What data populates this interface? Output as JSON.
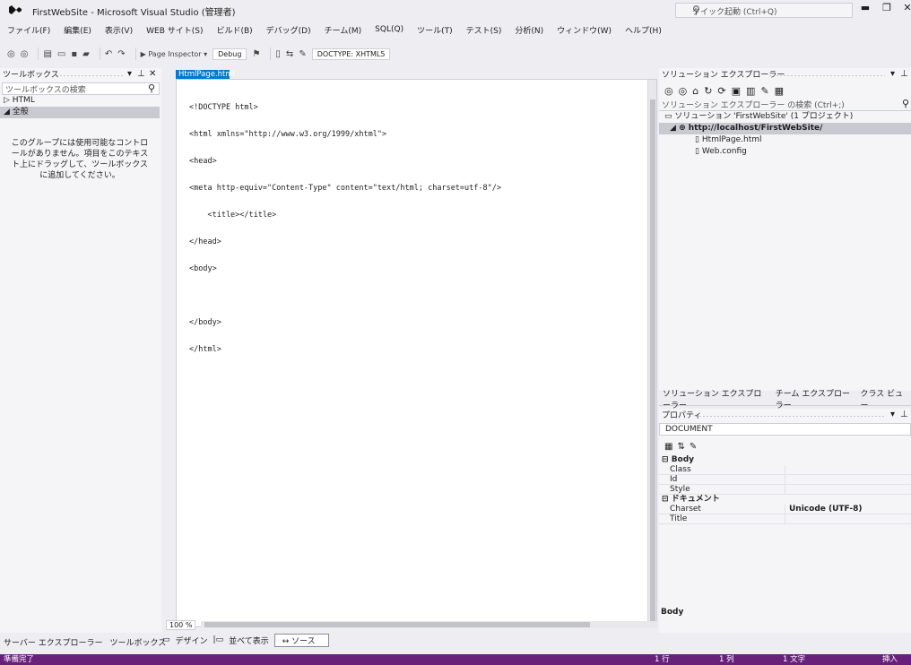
{
  "window": {
    "title": "FirstWebSite - Microsoft Visual Studio (管理者)",
    "quick_launch": "クイック起動 (Ctrl+Q)",
    "minimize": "▬",
    "maximize": "❐",
    "close": "✕"
  },
  "menu": [
    "ファイル(F)",
    "編集(E)",
    "表示(V)",
    "WEB サイト(S)",
    "ビルド(B)",
    "デバッグ(D)",
    "チーム(M)",
    "SQL(Q)",
    "ツール(T)",
    "テスト(S)",
    "分析(N)",
    "ウィンドウ(W)",
    "ヘルプ(H)"
  ],
  "toolbar": {
    "run_label": "▶ Page Inspector ▾",
    "config": "Debug",
    "doctype": "DOCTYPE: XHTML5"
  },
  "toolbox": {
    "title": "ツールボックス",
    "search_placeholder": "ツールボックスの検索",
    "groups": [
      "▷ HTML",
      "◢ 全般"
    ],
    "message": "このグループには使用可能なコントロールがありません。項目をこのテキスト上にドラッグして、ツールボックスに追加してください。"
  },
  "editor": {
    "tab": "HtmlPage.html",
    "lines": [
      "<!DOCTYPE html>",
      "<html xmlns=\"http://www.w3.org/1999/xhtml\">",
      "<head>",
      "<meta http-equiv=\"Content-Type\" content=\"text/html; charset=utf-8\"/>",
      "    <title></title>",
      "</head>",
      "<body>",
      "",
      "</body>",
      "</html>"
    ],
    "zoom": "100 %"
  },
  "view_tabs": {
    "design": "デザイン",
    "split": "並べて表示",
    "source": "ソース"
  },
  "left_bottom_tabs": [
    "サーバー エクスプローラー",
    "ツールボックス"
  ],
  "solution_explorer": {
    "title": "ソリューション エクスプローラー",
    "search_placeholder": "ソリューション エクスプローラー の検索 (Ctrl+;)",
    "solution": "ソリューション 'FirstWebSite' (1 プロジェクト)",
    "project": "http://localhost/FirstWebSite/",
    "files": [
      "HtmlPage.html",
      "Web.config"
    ],
    "tabs": [
      "ソリューション エクスプローラー",
      "チーム エクスプローラー",
      "クラス ビュー"
    ]
  },
  "properties": {
    "title": "プロパティ",
    "object": "DOCUMENT",
    "groups": [
      {
        "name": "Body",
        "rows": [
          [
            "Class",
            ""
          ],
          [
            "Id",
            ""
          ],
          [
            "Style",
            ""
          ]
        ]
      },
      {
        "name": "ドキュメント",
        "rows": [
          [
            "Charset",
            "Unicode (UTF-8)"
          ],
          [
            "Title",
            ""
          ]
        ]
      }
    ],
    "description": "Body"
  },
  "status": {
    "ready": "準備完了",
    "line": "1 行",
    "column": "1 列",
    "char": "1 文字",
    "mode": "挿入"
  }
}
